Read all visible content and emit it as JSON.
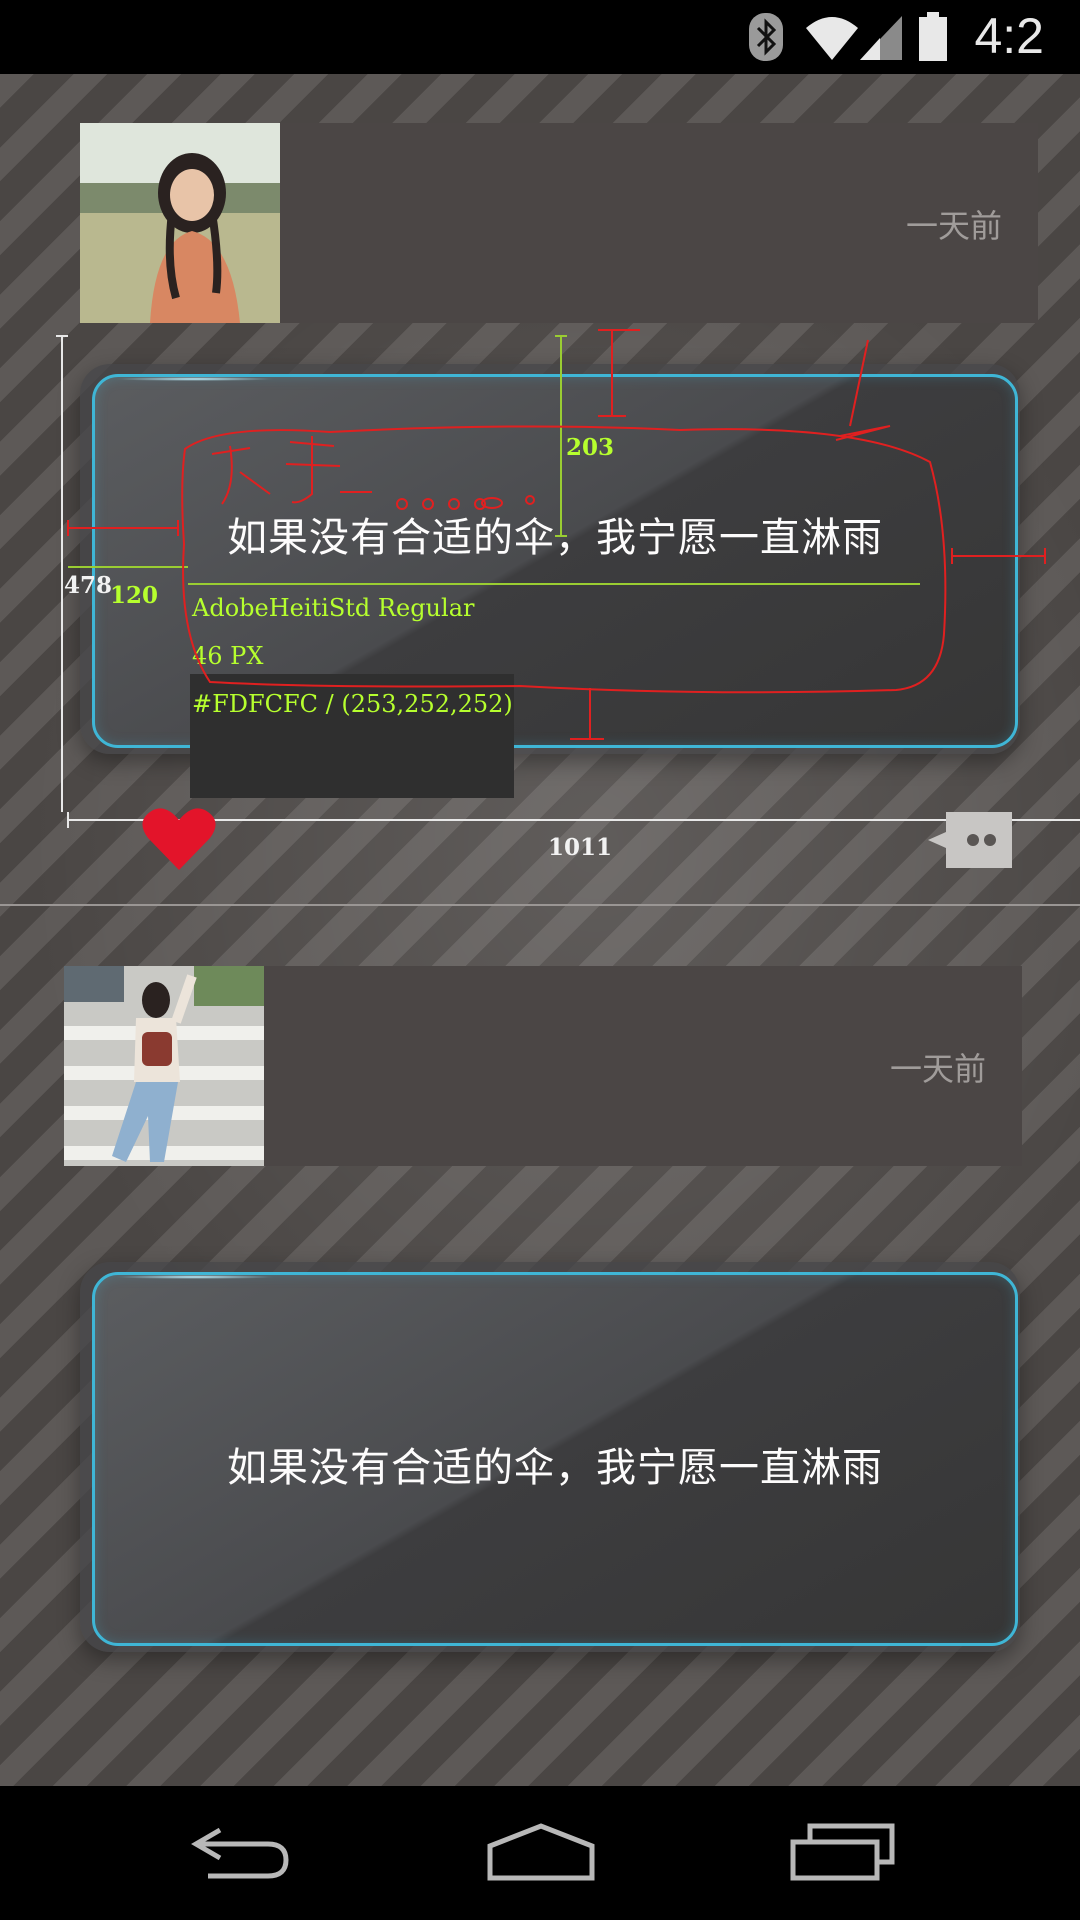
{
  "status_bar": {
    "time": "4:2",
    "icons": [
      "bluetooth-icon",
      "wifi-icon",
      "cell-signal-icon",
      "battery-icon"
    ]
  },
  "posts": [
    {
      "timestamp": "一天前",
      "avatar": "avatar-photo-girl-field",
      "card_text": "如果没有合适的伞，我宁愿一直淋雨"
    },
    {
      "timestamp": "一天前",
      "avatar": "avatar-photo-girl-street",
      "card_text": "如果没有合适的伞，我宁愿一直淋雨"
    }
  ],
  "annotation": {
    "font_name": "AdobeHeitiStd Regular",
    "font_size": "46 PX",
    "color_value": "#FDFCFC / (253,252,252)",
    "dim_height": "478",
    "dim_left": "120",
    "dim_top": "203",
    "dim_width": "1011",
    "handwriting": "文字……"
  },
  "actions": {
    "like_icon": "heart-icon",
    "comment_icon": "comment-icon"
  },
  "colors": {
    "card_border": "#3fb6d6",
    "text": "#FDFCFC",
    "heart": "#e3142a",
    "annotation_green": "#b6ff2e",
    "annotation_red": "#e02020"
  },
  "nav_bar": {
    "buttons": [
      "back-icon",
      "home-icon",
      "recents-icon"
    ]
  }
}
